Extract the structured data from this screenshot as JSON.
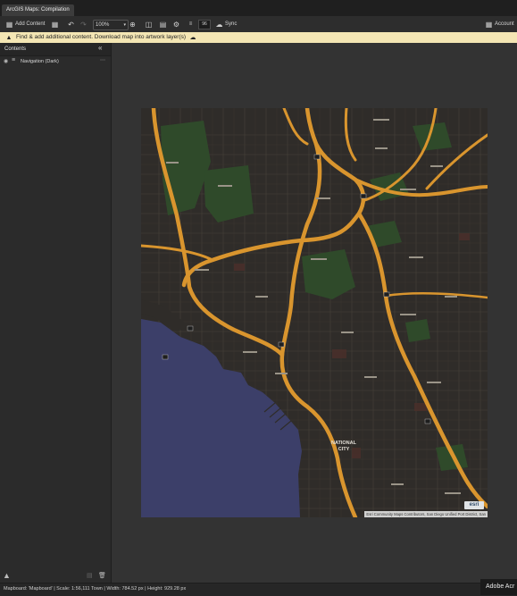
{
  "window": {
    "tab_title": "ArcGIS Maps: Compilation"
  },
  "toolbar": {
    "add_content_label": "Add Content",
    "zoom_value": "100%",
    "dpi_value": "96",
    "sync_label": "Sync",
    "account_label": "Account"
  },
  "notice": {
    "text": "Find & add additional content. Download map into artwork layer(s)"
  },
  "panel": {
    "title": "Contents",
    "layers": [
      {
        "name": "Navigation (Dark)"
      }
    ]
  },
  "map": {
    "labels": {
      "national_city": "NATIONAL\nCITY"
    },
    "attribution": "Esri Community Maps Contributors, San Diego Unified Port District, San",
    "logo": "esri",
    "colors": {
      "land": "#2f2c29",
      "water": "#3c3f69",
      "highway": "#d9952e",
      "park": "#2f4a2a"
    }
  },
  "status": {
    "text": "Mapboard: 'Mapboard' | Scale: 1:56,111 Town | Width: 784.52 px | Height: 929.28 px",
    "adobe": "Adobe Acr"
  }
}
